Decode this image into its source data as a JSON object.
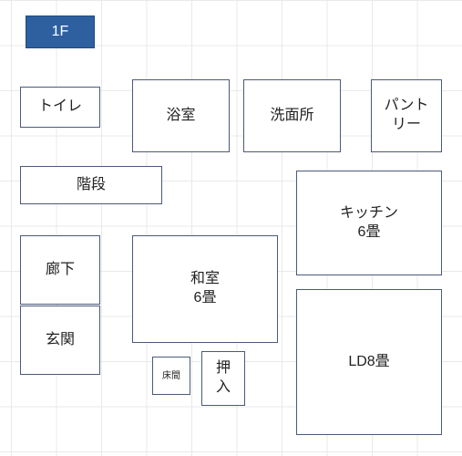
{
  "floor": {
    "title": "1F"
  },
  "rooms": {
    "toilet": {
      "label": "トイレ"
    },
    "bath": {
      "label": "浴室"
    },
    "washroom": {
      "label": "洗面所"
    },
    "pantry": {
      "label1": "パント",
      "label2": "リー"
    },
    "stairs": {
      "label": "階段"
    },
    "kitchen": {
      "label1": "キッチン",
      "label2": "6畳"
    },
    "hallway": {
      "label": "廊下"
    },
    "washitsu": {
      "label1": "和室",
      "label2": "6畳"
    },
    "entrance": {
      "label": "玄関"
    },
    "tokonoma": {
      "label": "床間"
    },
    "closet": {
      "label1": "押",
      "label2": "入"
    },
    "ld": {
      "label": "LD8畳"
    }
  }
}
